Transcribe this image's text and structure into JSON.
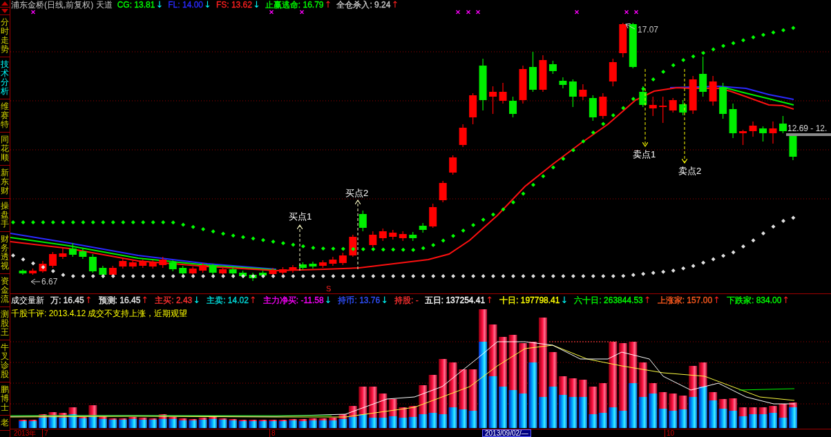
{
  "sidebar": {
    "tabs": [
      {
        "label": "分时走势",
        "selected": false
      },
      {
        "label": "技术分析",
        "selected": true
      },
      {
        "label": "维赛特",
        "selected": false
      },
      {
        "label": "同花顺",
        "selected": false
      },
      {
        "label": "新东财",
        "selected": false
      },
      {
        "label": "操盘手",
        "selected": false
      },
      {
        "label": "财务透视",
        "selected": false
      },
      {
        "label": "资金流",
        "selected": false
      },
      {
        "label": "测股王",
        "selected": false
      },
      {
        "label": "牛叉诊股",
        "selected": false
      },
      {
        "label": "鹏博士",
        "selected": false
      },
      {
        "label": "老",
        "selected": false
      }
    ]
  },
  "header": {
    "title": "浦东金桥(日线,前复权) 天道",
    "indicators": [
      {
        "text": "CG: 13.81",
        "arrow": "↓",
        "rising": false,
        "color": "#00ff00"
      },
      {
        "text": "FL: 14.00",
        "arrow": "↓",
        "rising": false,
        "color": "#2a2aff"
      },
      {
        "text": "FS: 13.62",
        "arrow": "↓",
        "rising": false,
        "color": "#ff2020"
      },
      {
        "text": "止赢逃命: 16.79",
        "arrow": "↑",
        "rising": true,
        "color": "#00ff00"
      },
      {
        "text": "全仓杀入: 9.24",
        "arrow": "↑",
        "rising": true,
        "color": "#c8c8c8"
      }
    ]
  },
  "main_chart": {
    "annotations": [
      {
        "kind": "price",
        "text": "17.07"
      },
      {
        "kind": "price",
        "text": "6.67"
      },
      {
        "kind": "buy",
        "text": "买点1"
      },
      {
        "kind": "buy",
        "text": "买点2"
      },
      {
        "kind": "sell",
        "text": "卖点1"
      },
      {
        "kind": "sell",
        "text": "卖点2"
      },
      {
        "kind": "signal",
        "text": "S"
      },
      {
        "kind": "cursor",
        "text": "12.69 - 12."
      }
    ]
  },
  "volume_panel": {
    "title": "成交量新",
    "indicators": [
      {
        "text": "万: 16.45",
        "arrow": "↑",
        "rising": true,
        "color": "#e8e8e8"
      },
      {
        "text": "预测: 16.45",
        "arrow": "↑",
        "rising": true,
        "color": "#e8e8e8"
      },
      {
        "text": "主买: 2.43",
        "arrow": "↓",
        "rising": false,
        "color": "#ff3030"
      },
      {
        "text": "主卖: 14.02",
        "arrow": "↑",
        "rising": true,
        "color": "#00d8d8"
      },
      {
        "text": "主力净买: -11.58",
        "arrow": "↓",
        "rising": false,
        "color": "#ff00ff"
      },
      {
        "text": "持币: 13.76",
        "arrow": "↓",
        "rising": false,
        "color": "#3050ff"
      },
      {
        "text": "持股: -",
        "color": "#ff3030"
      },
      {
        "text": "五日: 137254.41",
        "arrow": "↑",
        "rising": true,
        "color": "#ffffff"
      },
      {
        "text": "十日: 197798.41",
        "arrow": "↓",
        "rising": false,
        "color": "#ffff00"
      },
      {
        "text": "六十日: 263844.53",
        "arrow": "↑",
        "rising": true,
        "color": "#00ff00"
      },
      {
        "text": "上涨家: 157.00",
        "arrow": "↑",
        "rising": true,
        "color": "#ff5a1e"
      },
      {
        "text": "下跌家: 834.00",
        "arrow": "↑",
        "rising": true,
        "color": "#00ff00"
      }
    ],
    "comment": "千股千评: 2013.4.12 成交不支持上涨，近期观望"
  },
  "time_axis": {
    "labels": [
      {
        "text": "2013年",
        "kind": "year"
      },
      {
        "text": "7",
        "kind": "tick"
      },
      {
        "text": "8",
        "kind": "tick"
      },
      {
        "text": "2013/09/02/—",
        "kind": "cursor"
      },
      {
        "text": "10",
        "kind": "tick"
      }
    ]
  }
}
